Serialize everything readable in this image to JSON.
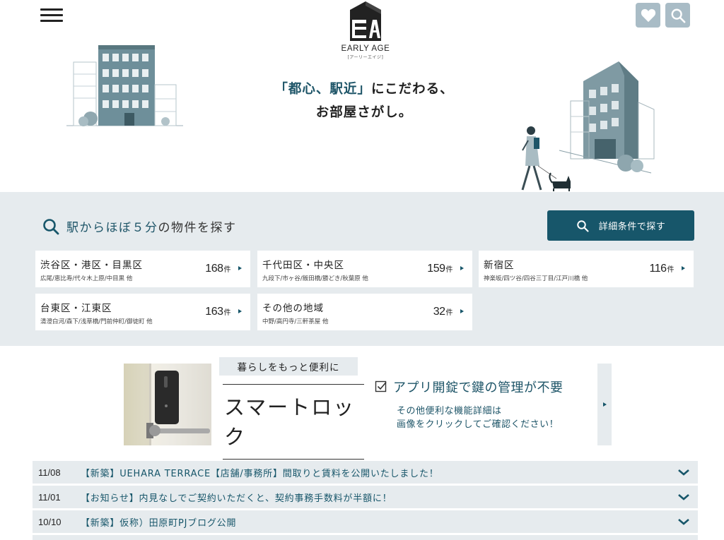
{
  "header": {
    "menu_icon": "hamburger-icon",
    "logo": {
      "mark": "EA",
      "name": "EARLY AGE",
      "sub": "[アーリーエイジ]"
    },
    "favorite_icon": "heart-icon",
    "search_icon": "search-icon",
    "button_color": "#a9bcc6"
  },
  "hero": {
    "tagline_accent": "「都心、駅近」",
    "tagline_rest": "にこだわる、",
    "tagline_line2": "お部屋さがし。"
  },
  "search": {
    "title_highlight": "駅からほぼ５分",
    "title_rest": "の物件を探す",
    "detail_button": "詳細条件で探す",
    "accent_color": "#17566a",
    "areas": [
      {
        "name": "渋谷区・港区・目黒区",
        "stations": "広尾/恵比寿/代々木上原/中目黒 他",
        "count": "168",
        "unit": "件"
      },
      {
        "name": "千代田区・中央区",
        "stations": "九段下/市ヶ谷/飯田橋/勝どき/秋葉原 他",
        "count": "159",
        "unit": "件"
      },
      {
        "name": "新宿区",
        "stations": "神楽坂/四ツ谷/四谷三丁目/江戸川橋 他",
        "count": "116",
        "unit": "件"
      },
      {
        "name": "台東区・江東区",
        "stations": "清澄白河/森下/浅草橋/門前仲町/御徒町 他",
        "count": "163",
        "unit": "件"
      },
      {
        "name": "その他の地域",
        "stations": "中野/高円寺/三軒茶屋 他",
        "count": "32",
        "unit": "件"
      }
    ]
  },
  "banner": {
    "kicker": "暮らしをもっと便利に",
    "title": "スマートロック",
    "feature": "アプリ開錠で鍵の管理が不要",
    "note_line1": "その他便利な機能詳細は",
    "note_line2": "画像をクリックしてご確認ください！"
  },
  "news": [
    {
      "date": "11/08",
      "text": "【新築】UEHARA TERRACE【店舗/事務所】間取りと賃料を公開いたしました！"
    },
    {
      "date": "11/01",
      "text": "【お知らせ】内見なしでご契約いただくと、契約事務手数料が半額に！"
    },
    {
      "date": "10/10",
      "text": "【新築】仮称）田原町PJブログ公開"
    }
  ]
}
